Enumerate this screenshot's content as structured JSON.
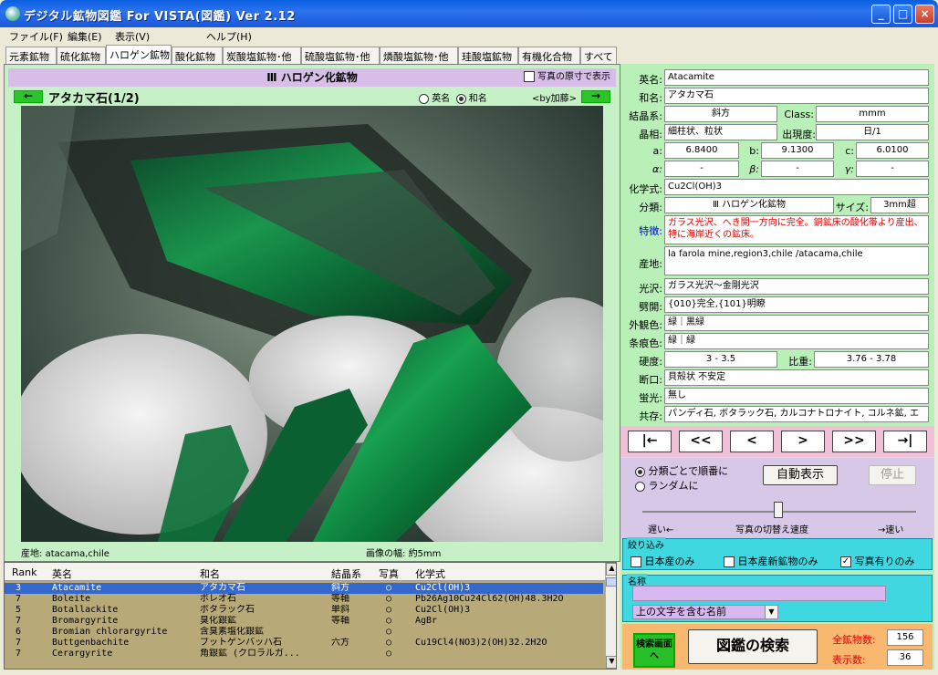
{
  "window": {
    "title": "デジタル鉱物図鑑 For VISTA(図鑑) Ver 2.12",
    "minimize": "_",
    "maximize": "□",
    "close": "×"
  },
  "menu": [
    "ファイル(F)",
    "編集(E)",
    "表示(V)",
    "ヘルプ(H)"
  ],
  "tabs": [
    "元素鉱物",
    "硫化鉱物",
    "ハロゲン鉱物",
    "酸化鉱物",
    "炭酸塩鉱物･他",
    "硫酸塩鉱物･他",
    "燐酸塩鉱物･他",
    "珪酸塩鉱物",
    "有機化合物",
    "すべて"
  ],
  "active_tab": 2,
  "section": {
    "title": "Ⅲ ハロゲン化鉱物",
    "original_size_label": "写真の原寸で表示"
  },
  "mineral_nav": {
    "prev": "←",
    "next": "→",
    "name": "アタカマ石(1/2)",
    "radio_en": "英名",
    "radio_ja": "和名",
    "by": "<by加藤>"
  },
  "photo_caption": {
    "locality_label": "産地:",
    "locality": "atacama,chile",
    "width_label": "画像の幅:",
    "width": "約5mm"
  },
  "grid": {
    "headers": [
      "Rank",
      "英名",
      "和名",
      "結晶系",
      "写真",
      "化学式"
    ],
    "rows": [
      {
        "rank": "3",
        "en": "Atacamite",
        "ja": "アタカマ石",
        "sys": "斜方",
        "photo": "○",
        "formula": "Cu2Cl(OH)3",
        "selected": true
      },
      {
        "rank": "7",
        "en": "Boleite",
        "ja": "ボレオ石",
        "sys": "等軸",
        "photo": "○",
        "formula": "Pb26Ag10Cu24Cl62(OH)48.3H2O",
        "selected": false
      },
      {
        "rank": "5",
        "en": "Botallackite",
        "ja": "ボタラック石",
        "sys": "単斜",
        "photo": "○",
        "formula": "Cu2Cl(OH)3",
        "selected": false
      },
      {
        "rank": "7",
        "en": "Bromargyrite",
        "ja": "臭化銀鉱",
        "sys": "等軸",
        "photo": "○",
        "formula": "AgBr",
        "selected": false
      },
      {
        "rank": "6",
        "en": "Bromian chlorargyrite",
        "ja": "含臭素塩化銀鉱",
        "sys": "",
        "photo": "○",
        "formula": "",
        "selected": false
      },
      {
        "rank": "7",
        "en": "Buttgenbachite",
        "ja": "ブットゲンバッハ石",
        "sys": "六方",
        "photo": "○",
        "formula": "Cu19Cl4(NO3)2(OH)32.2H2O",
        "selected": false
      },
      {
        "rank": "7",
        "en": "Cerargyrite",
        "ja": "角銀鉱 (クロラルガ...",
        "sys": "",
        "photo": "○",
        "formula": "",
        "selected": false
      }
    ]
  },
  "details": {
    "en_label": "英名:",
    "en": "Atacamite",
    "ja_label": "和名:",
    "ja": "アタカマ石",
    "sys_label": "結晶系:",
    "sys": "斜方",
    "class_label": "Class:",
    "class": "mmm",
    "habit_label": "晶相:",
    "habit": "細柱状、粒状",
    "freq_label": "出現度:",
    "freq": "日/1",
    "a_label": "a:",
    "a": "6.8400",
    "b_label": "b:",
    "b": "9.1300",
    "c_label": "c:",
    "c": "6.0100",
    "alpha_label": "α:",
    "alpha": "-",
    "beta_label": "β:",
    "beta": "-",
    "gamma_label": "γ:",
    "gamma": "-",
    "formula_label": "化学式:",
    "formula": "Cu2Cl(OH)3",
    "category_label": "分類:",
    "category": "Ⅲ ハロゲン化鉱物",
    "size_label": "サイズ:",
    "size": "3mm超",
    "feature_label": "特徴:",
    "feature": "ガラス光沢、へき開一方向に完全。銅鉱床の酸化帯より産出、特に海岸近くの鉱床。",
    "locality_label": "産地:",
    "locality": "la farola mine,region3,chile /atacama,chile",
    "luster_label": "光沢:",
    "luster": "ガラス光沢～金剛光沢",
    "cleavage_label": "劈開:",
    "cleavage": "{010}完全,{101}明瞭",
    "color_label": "外観色:",
    "color": "緑｜黒緑",
    "streak_label": "条痕色:",
    "streak": "緑｜緑",
    "hardness_label": "硬度:",
    "hardness": "3 - 3.5",
    "gravity_label": "比重:",
    "gravity": "3.76 - 3.78",
    "fracture_label": "断口:",
    "fracture": "貝殻状 不安定",
    "fluor_label": "蛍光:",
    "fluor": "無し",
    "assoc_label": "共存:",
    "assoc": "パンディ石, ボタラック石, カルコナトロナイト, コルネ鉱, エ"
  },
  "nav_buttons": [
    "|←",
    "<<",
    "<",
    ">",
    ">>",
    "→|"
  ],
  "auto": {
    "opt1": "分類ごとで順番に",
    "opt2": "ランダムに",
    "start": "自動表示",
    "stop": "停止",
    "slow": "遅い←",
    "label": "写真の切替え速度",
    "fast": "→速い"
  },
  "filter": {
    "title": "絞り込み",
    "japan": "日本産のみ",
    "japan_new": "日本産新鉱物のみ",
    "photo_only": "写真有りのみ",
    "photo_checked": true
  },
  "name_search": {
    "title": "名称",
    "mode": "上の文字を含む名前"
  },
  "bottom": {
    "search_screen": "検索画面へ",
    "search_button": "図鑑の検索",
    "total_label": "全鉱物数:",
    "total": "156",
    "shown_label": "表示数:",
    "shown": "36"
  },
  "colors": {
    "green": "#c6f0c6",
    "purple": "#d8bde8",
    "cyan": "#40d8e0",
    "orange": "#f8b870",
    "pink": "#f0c0d8",
    "red_text": "#e00000"
  }
}
